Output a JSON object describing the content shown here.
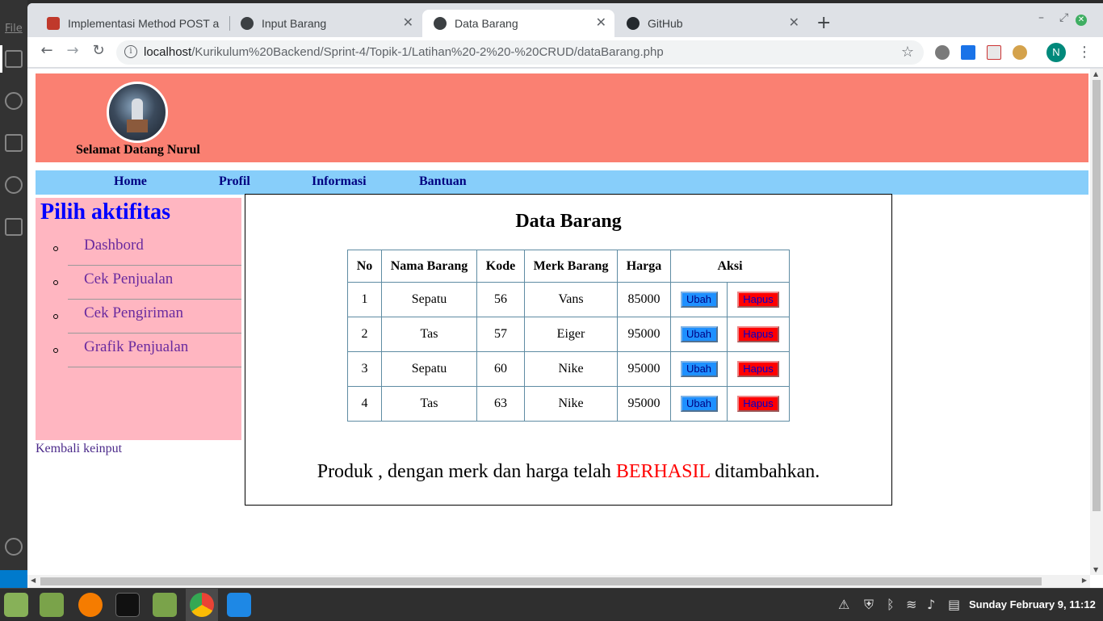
{
  "desktop": {
    "file_menu": "File",
    "clock": "Sunday February  9, 11:12"
  },
  "browser": {
    "tabs": [
      {
        "label": "Implementasi Method POST a",
        "active": false
      },
      {
        "label": "Input Barang",
        "active": false
      },
      {
        "label": "Data Barang",
        "active": true
      },
      {
        "label": "GitHub",
        "active": false
      }
    ],
    "url_host": "localhost",
    "url_path": "/Kurikulum%20Backend/Sprint-4/Topik-1/Latihan%20-2%20-%20CRUD/dataBarang.php",
    "profile_initial": "N"
  },
  "page": {
    "welcome": "Selamat Datang Nurul",
    "nav": [
      "Home",
      "Profil",
      "Informasi",
      "Bantuan"
    ],
    "sidebar": {
      "title": "Pilih aktifitas",
      "items": [
        "Dashbord",
        "Cek Penjualan",
        "Cek Pengiriman",
        "Grafik Penjualan"
      ]
    },
    "back_link": "Kembali keinput",
    "content": {
      "title": "Data Barang",
      "headers": [
        "No",
        "Nama Barang",
        "Kode",
        "Merk Barang",
        "Harga",
        "Aksi"
      ],
      "rows": [
        {
          "no": "1",
          "nama": "Sepatu",
          "kode": "56",
          "merk": "Vans",
          "harga": "85000"
        },
        {
          "no": "2",
          "nama": "Tas",
          "kode": "57",
          "merk": "Eiger",
          "harga": "95000"
        },
        {
          "no": "3",
          "nama": "Sepatu",
          "kode": "60",
          "merk": "Nike",
          "harga": "95000"
        },
        {
          "no": "4",
          "nama": "Tas",
          "kode": "63",
          "merk": "Nike",
          "harga": "95000"
        }
      ],
      "btn_ubah": "Ubah",
      "btn_hapus": "Hapus",
      "message_before": "Produk , dengan merk dan harga telah ",
      "message_status": "BERHASIL",
      "message_after": " ditambahkan."
    }
  },
  "colors": {
    "header_bg": "#fa8072",
    "nav_bg": "#87cefa",
    "sidebar_bg": "#ffb6c1",
    "success_color": "#ff0000"
  }
}
